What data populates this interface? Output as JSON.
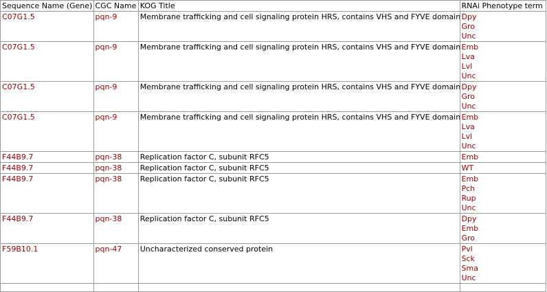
{
  "columns": [
    "Sequence Name (Gene)",
    "CGC Name",
    "KOG Title",
    "RNAi Phenotype term"
  ],
  "colors": {
    "link": "#990000",
    "border": "#9a9a9a"
  },
  "rows": [
    {
      "seq": "C07G1.5",
      "cgc": "pqn-9",
      "kog": "Membrane trafficking and cell signaling protein HRS, contains VHS and FYVE domains",
      "phenotypes": [
        "Dpy",
        "Gro",
        "Unc"
      ]
    },
    {
      "seq": "C07G1.5",
      "cgc": "pqn-9",
      "kog": "Membrane trafficking and cell signaling protein HRS, contains VHS and FYVE domains",
      "phenotypes": [
        "Emb",
        "Lva",
        "Lvl",
        "Unc"
      ]
    },
    {
      "seq": "C07G1.5",
      "cgc": "pqn-9",
      "kog": "Membrane trafficking and cell signaling protein HRS, contains VHS and FYVE domains",
      "phenotypes": [
        "Dpy",
        "Gro",
        "Unc"
      ]
    },
    {
      "seq": "C07G1.5",
      "cgc": "pqn-9",
      "kog": "Membrane trafficking and cell signaling protein HRS, contains VHS and FYVE domains",
      "phenotypes": [
        "Emb",
        "Lva",
        "Lvl",
        "Unc"
      ]
    },
    {
      "seq": "F44B9.7",
      "cgc": "pqn-38",
      "kog": "Replication factor C, subunit RFC5",
      "phenotypes": [
        "Emb"
      ]
    },
    {
      "seq": "F44B9.7",
      "cgc": "pqn-38",
      "kog": "Replication factor C, subunit RFC5",
      "phenotypes": [
        "WT"
      ]
    },
    {
      "seq": "F44B9.7",
      "cgc": "pqn-38",
      "kog": "Replication factor C, subunit RFC5",
      "phenotypes": [
        "Emb",
        "Pch",
        "Rup",
        "Unc"
      ]
    },
    {
      "seq": "F44B9.7",
      "cgc": "pqn-38",
      "kog": "Replication factor C, subunit RFC5",
      "phenotypes": [
        "Dpy",
        "Emb",
        "Gro"
      ]
    },
    {
      "seq": "F59B10.1",
      "cgc": "pqn-47",
      "kog": "Uncharacterized conserved protein",
      "phenotypes": [
        "Pvl",
        "Sck",
        "Sma",
        "Unc"
      ]
    }
  ]
}
